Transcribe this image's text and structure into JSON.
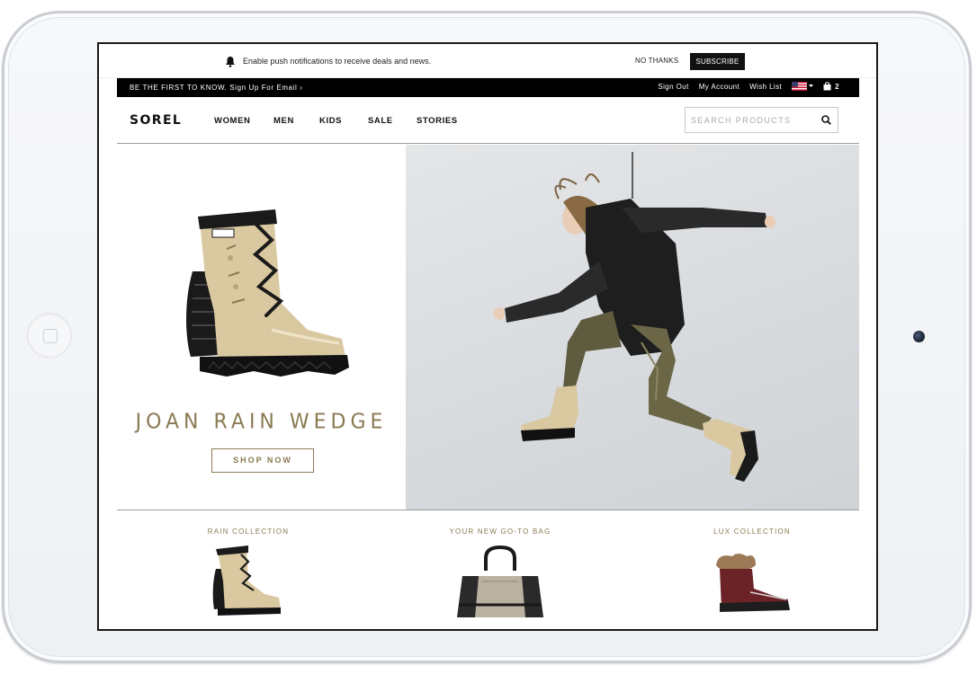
{
  "push": {
    "message": "Enable push notifications to receive deals and news.",
    "no_thanks": "NO THANKS",
    "subscribe": "SUBSCRIBE"
  },
  "promo": {
    "text": "BE THE FIRST TO KNOW. Sign Up For Email ›",
    "links": [
      "Sign Out",
      "My Account",
      "Wish List"
    ],
    "cart_count": "2"
  },
  "header": {
    "logo": "SOREL",
    "nav": [
      "WOMEN",
      "MEN",
      "KIDS",
      "SALE",
      "STORIES"
    ],
    "search_placeholder": "SEARCH PRODUCTS"
  },
  "hero": {
    "title": "JOAN RAIN WEDGE",
    "button": "SHOP NOW"
  },
  "collections": [
    {
      "label": "RAIN COLLECTION"
    },
    {
      "label": "YOUR NEW GO-TO BAG"
    },
    {
      "label": "LUX COLLECTION"
    }
  ],
  "colors": {
    "accent": "#8a7a52",
    "black": "#000000",
    "boot_tan": "#d9c8a0",
    "pants_olive": "#5f5b3e"
  }
}
